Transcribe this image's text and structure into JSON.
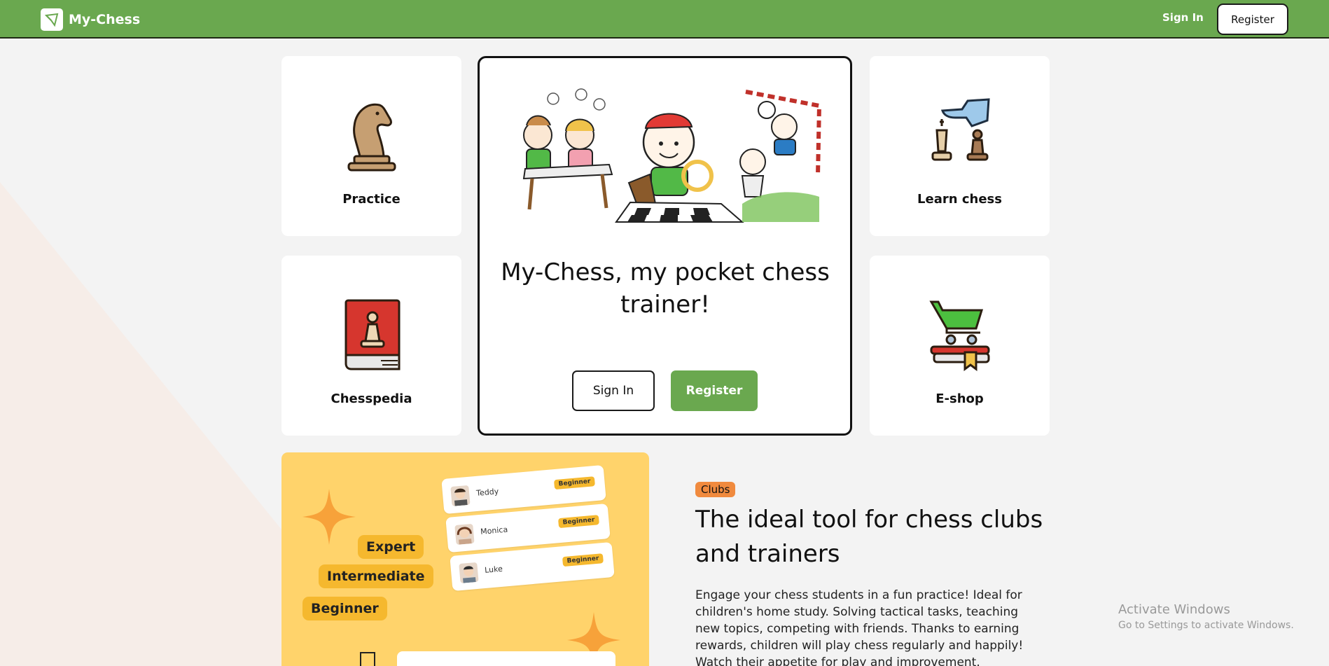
{
  "navbar": {
    "brand": "My-Chess",
    "signin_label": "Sign In",
    "register_label": "Register",
    "color": "#6aa84f"
  },
  "cards": [
    {
      "label": "Practice",
      "icon": "knight-icon"
    },
    {
      "label": "Learn chess",
      "icon": "hand-moving-king-icon"
    },
    {
      "label": "Chesspedia",
      "icon": "book-pawn-icon"
    },
    {
      "label": "E-shop",
      "icon": "cart-icon"
    }
  ],
  "hero": {
    "title": "My-Chess, my pocket chess trainer!",
    "signin_label": "Sign In",
    "register_label": "Register",
    "art": "kids-playing-chess-illustration"
  },
  "promo": {
    "levels": [
      "Expert",
      "Intermediate",
      "Beginner"
    ],
    "students": [
      {
        "name": "Teddy",
        "level": "Beginner"
      },
      {
        "name": "Monica",
        "level": "Beginner"
      },
      {
        "name": "Luke",
        "level": "Beginner"
      }
    ],
    "accent": "#ffd36b"
  },
  "clubs": {
    "tag": "Clubs",
    "title": "The ideal tool for chess clubs and trainers",
    "body": "Engage your chess students in a fun practice! Ideal for children's home study. Solving tactical tasks, teaching new topics, competing with friends. Thanks to earning rewards, children will play chess regularly and happily! Watch their appetite for play and improvement."
  },
  "windows_activation": {
    "title": "Activate Windows",
    "subtitle": "Go to Settings to activate Windows."
  }
}
